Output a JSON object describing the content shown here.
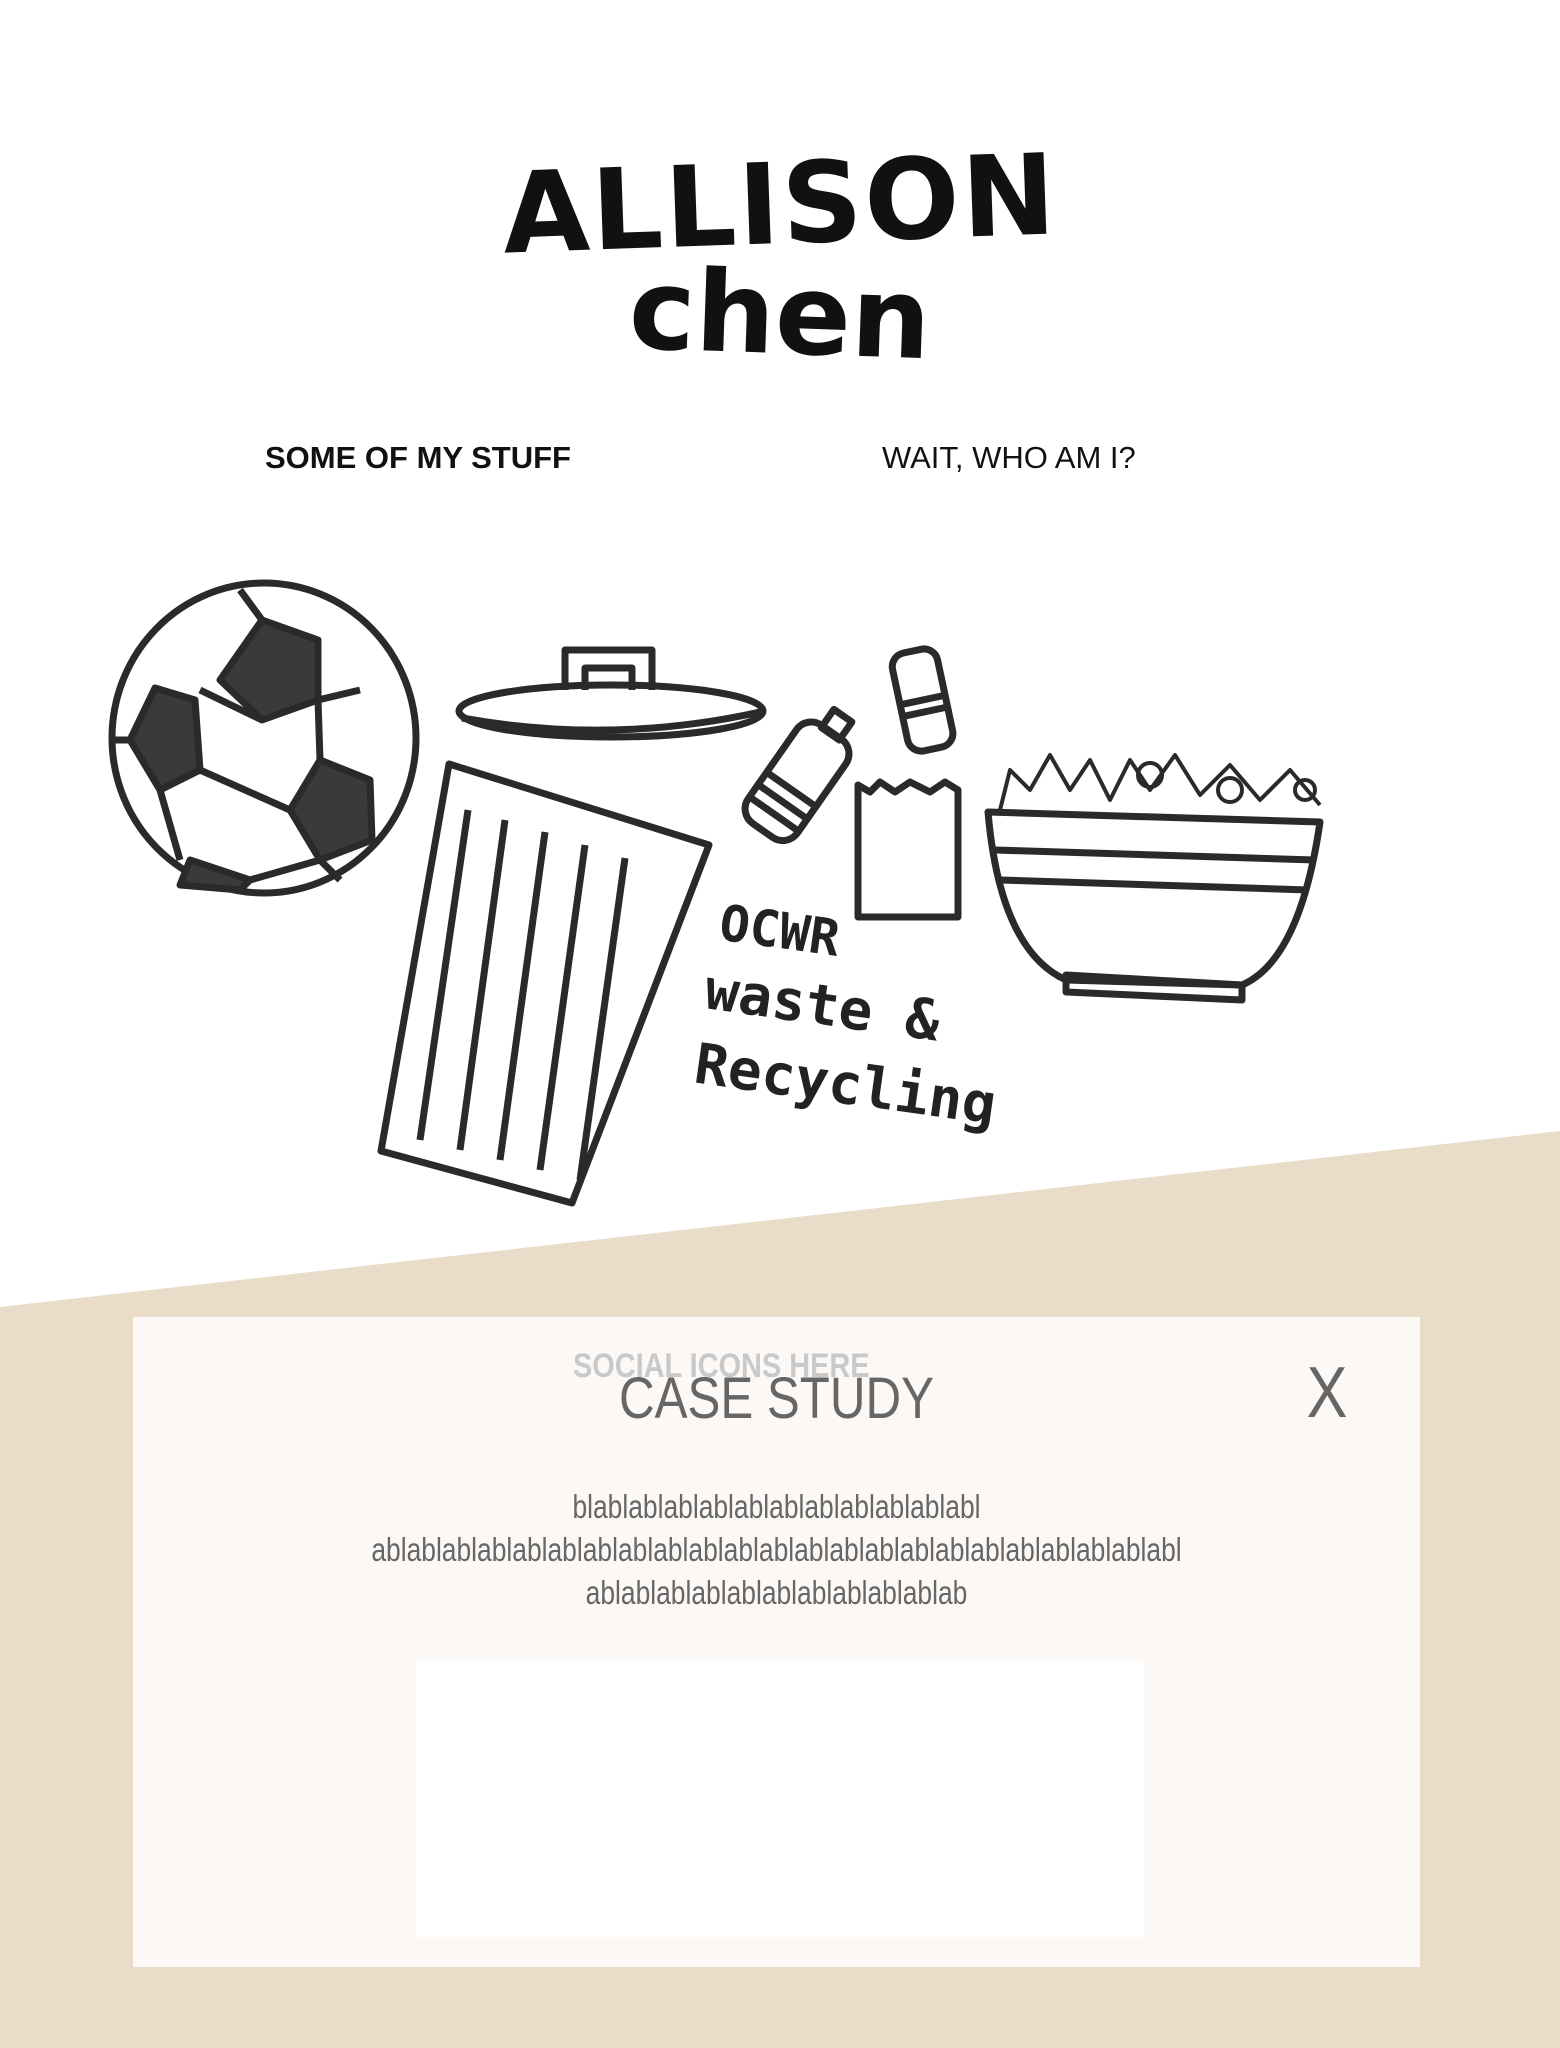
{
  "header": {
    "name_line1": "ALLISON",
    "name_line2": "chen"
  },
  "nav": {
    "items": [
      {
        "label": "SOME OF MY STUFF"
      },
      {
        "label": "WAIT, WHO AM I?"
      }
    ]
  },
  "illustration": {
    "caption_lines": [
      "OCWR",
      "waste &",
      "Recycling"
    ]
  },
  "colors": {
    "band": "#e9dcc8",
    "panel": "#fcf8f5",
    "text_gray": "#666666"
  },
  "modal": {
    "social_placeholder": "SOCIAL ICONS HERE",
    "title": "CASE STUDY",
    "close_label": "X",
    "body_lines": [
      "blablablablablablablablablablablabl",
      "ablablablablablablablablablablablablablablablablablablablablablablabl",
      "ablablablablablablablablablablab"
    ]
  }
}
